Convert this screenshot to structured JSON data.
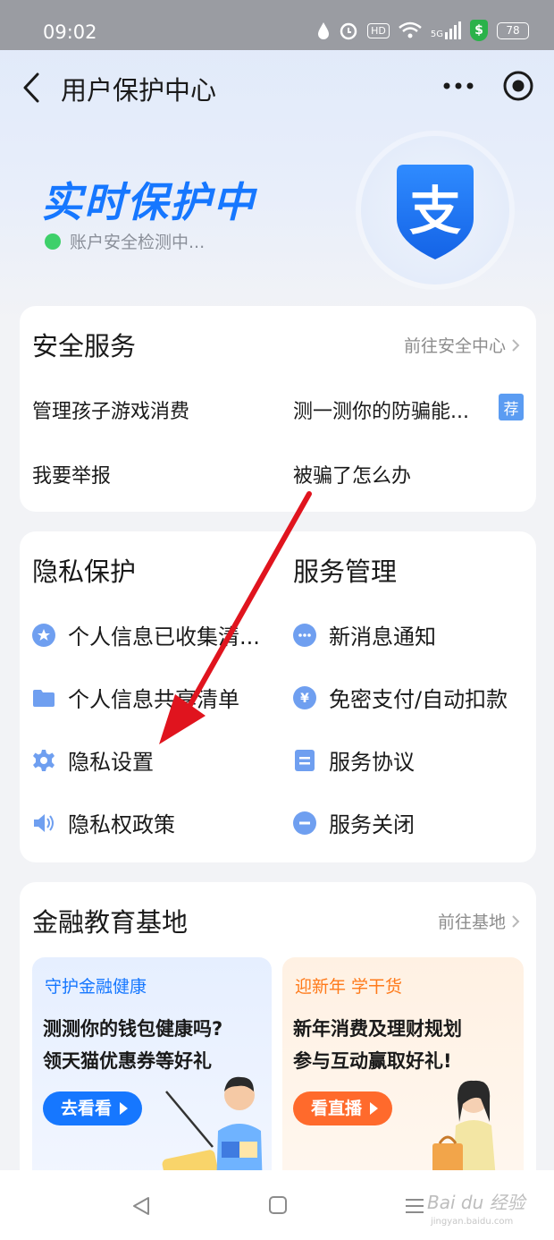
{
  "status_bar": {
    "time": "09:02",
    "hd": "HD",
    "signal": "5G",
    "battery": "78"
  },
  "nav": {
    "title": "用户保护中心"
  },
  "hero": {
    "title": "实时保护中",
    "status": "账户安全检测中...",
    "logo_char": "支"
  },
  "security": {
    "title": "安全服务",
    "link": "前往安全中心",
    "items": [
      "管理孩子游戏消费",
      "测一测你的防骗能...",
      "我要举报",
      "被骗了怎么办"
    ],
    "badge": "荐"
  },
  "privacy": {
    "title": "隐私保护",
    "items": [
      "个人信息已收集清...",
      "个人信息共享清单",
      "隐私设置",
      "隐私权政策"
    ]
  },
  "service": {
    "title": "服务管理",
    "items": [
      "新消息通知",
      "免密支付/自动扣款",
      "服务协议",
      "服务关闭"
    ]
  },
  "finance": {
    "title": "金融教育基地",
    "link": "前往基地",
    "promo1": {
      "tag": "守护金融健康",
      "line1": "测测你的钱包健康吗?",
      "line2": "领天猫优惠券等好礼",
      "button": "去看看"
    },
    "promo2": {
      "tag": "迎新年 学干货",
      "line1": "新年消费及理财规划",
      "line2": "参与互动赢取好礼!",
      "button": "看直播"
    }
  },
  "watermark": {
    "text": "Bai du 经验",
    "sub": "jingyan.baidu.com"
  },
  "colors": {
    "accent": "#1677ff",
    "icon_blue": "#6f9ff0",
    "arrow": "#e0141e",
    "orange": "#ff6a2c"
  }
}
